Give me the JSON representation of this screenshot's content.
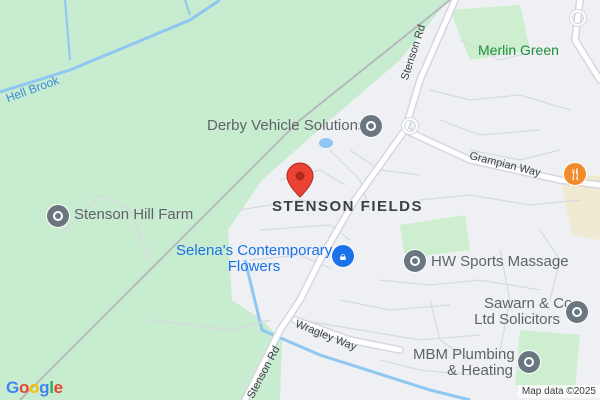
{
  "map": {
    "colors": {
      "park": "#c8ecd0",
      "urban": "#eef0f3",
      "road": "#ffffff",
      "road_casing": "#d4d8de",
      "water": "#8fc6f2",
      "railway": "#b5b9bd",
      "marker": "#ea4335"
    },
    "area_label": "STENSON FIELDS",
    "green_label": "Merlin Green",
    "water_label": "Hell Brook",
    "roads": [
      {
        "name": "Stenson Rd"
      },
      {
        "name": "Grampian Way"
      },
      {
        "name": "Stenson Rd"
      },
      {
        "name": "Wragley Way"
      }
    ],
    "places": [
      {
        "name": "Stenson Hill Farm",
        "icon": "place-pin-icon"
      },
      {
        "name": "Derby Vehicle Solutions",
        "icon": "place-pin-icon"
      },
      {
        "name": "HW Sports Massage",
        "icon": "place-pin-icon"
      },
      {
        "name": "Sawarn & Co",
        "name_line2": "Ltd Solicitors",
        "icon": "place-pin-icon"
      },
      {
        "name": "MBM Plumbing",
        "name_line2": "& Heating",
        "icon": "place-pin-icon"
      },
      {
        "name": "Selena's Contemporary",
        "name_line2": "Flowers",
        "icon": "shopping-bag-icon"
      },
      {
        "name": "",
        "icon": "restaurant-icon"
      }
    ],
    "logo": "Google",
    "attribution": "Map data ©2025"
  }
}
